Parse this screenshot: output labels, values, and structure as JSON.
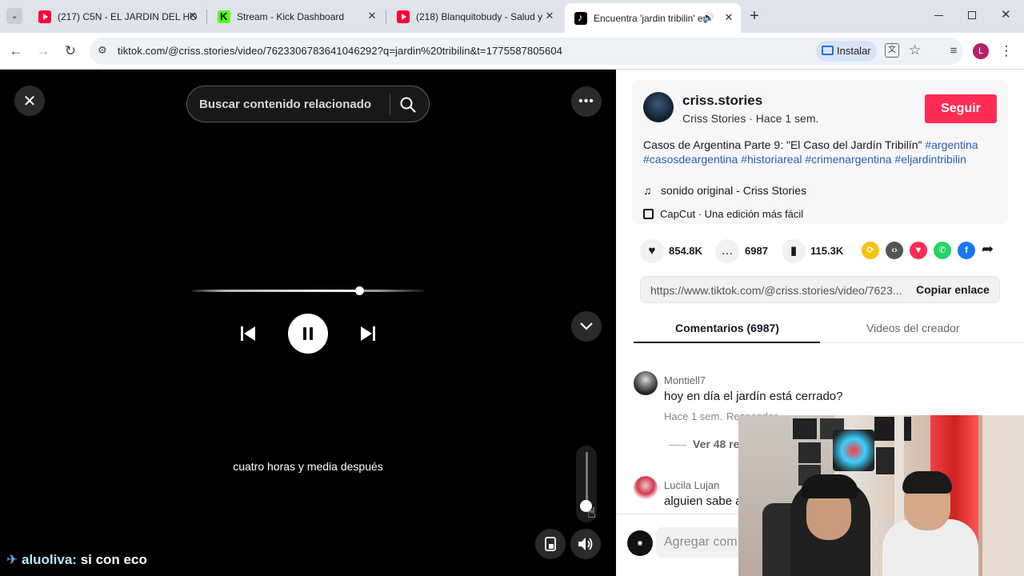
{
  "browser": {
    "tabs": [
      {
        "title": "(217) C5N - EL JARDIN DEL HO",
        "favicon": "youtube-icon"
      },
      {
        "title": "Stream - Kick Dashboard",
        "favicon": "kick-icon"
      },
      {
        "title": "(218) Blanquitobudy - Salud y F",
        "favicon": "youtube-icon"
      },
      {
        "title": "Encuentra 'jardin tribilin' en",
        "favicon": "tiktok-icon"
      }
    ],
    "new_tab_symbol": "+",
    "url": "tiktok.com/@criss.stories/video/7623306783641046292?q=jardin%20tribilin&t=1775587805604",
    "install_label": "Instalar",
    "profile_initial": "L"
  },
  "video": {
    "search_placeholder": "Buscar contenido relacionado",
    "subtitle": "cuatro horas y media después",
    "progress_fraction": 0.72,
    "volume_fraction": 0.05
  },
  "overlay_chat": {
    "user": "aluoliva:",
    "message": "si con eco"
  },
  "post": {
    "username": "criss.stories",
    "subline": "Criss Stories · Hace 1 sem.",
    "follow_label": "Seguir",
    "description": "Casos de Argentina Parte 9: \"El Caso del Jardín Tribilín\"",
    "hashtags": [
      "#argentina",
      "#casosdeargentina",
      "#historiareal",
      "#crimenargentina",
      "#eljardintribilin"
    ],
    "sound": "sonido original - Criss Stories",
    "capcut": "CapCut · Una edición más fácil",
    "likes": "854.8K",
    "comments": "6987",
    "saves": "115.3K",
    "link": "https://www.tiktok.com/@criss.stories/video/7623...",
    "copy_link_label": "Copiar enlace"
  },
  "panel_tabs": {
    "comments": "Comentarios (6987)",
    "creator_videos": "Videos del creador"
  },
  "comments": [
    {
      "user": "Montiell7",
      "text": "hoy en día el jardín está cerrado?",
      "time": "Hace 1 sem.",
      "reply": "Responder",
      "more": "Ver 48 re"
    },
    {
      "user": "Lucila Lujan",
      "text": "alguien sabe a"
    }
  ],
  "add_comment_placeholder": "Agregar com",
  "colors": {
    "follow": "#fe2c55",
    "hashtag": "#2b5db9",
    "tab_bar": "#dfe3eb"
  }
}
